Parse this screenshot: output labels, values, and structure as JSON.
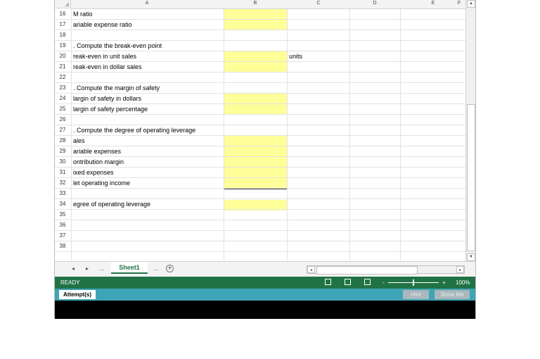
{
  "columns": [
    "A",
    "B",
    "C",
    "D",
    "E",
    "F"
  ],
  "rows": [
    {
      "num": "16",
      "a": "M ratio",
      "c": ""
    },
    {
      "num": "17",
      "a": "ariable expense ratio",
      "c": ""
    },
    {
      "num": "18",
      "a": "",
      "c": ""
    },
    {
      "num": "19",
      "a": ". Compute the break-even point",
      "c": ""
    },
    {
      "num": "20",
      "a": "reak-even in unit sales",
      "c": "units"
    },
    {
      "num": "21",
      "a": "reak-even in dollar sales",
      "c": ""
    },
    {
      "num": "22",
      "a": "",
      "c": ""
    },
    {
      "num": "23",
      "a": ". Compute the margin of safety",
      "c": ""
    },
    {
      "num": "24",
      "a": "largin of safety in dollars",
      "c": ""
    },
    {
      "num": "25",
      "a": "largin of safety percentage",
      "c": ""
    },
    {
      "num": "26",
      "a": "",
      "c": ""
    },
    {
      "num": "27",
      "a": ". Compute the degree of operating leverage",
      "c": ""
    },
    {
      "num": "28",
      "a": "ales",
      "c": ""
    },
    {
      "num": "29",
      "a": "ariable expenses",
      "c": ""
    },
    {
      "num": "30",
      "a": "ontribution margin",
      "c": ""
    },
    {
      "num": "31",
      "a": "ixed expenses",
      "c": ""
    },
    {
      "num": "32",
      "a": "let operating income",
      "c": ""
    },
    {
      "num": "33",
      "a": "",
      "c": ""
    },
    {
      "num": "34",
      "a": "egree of operating leverage",
      "c": ""
    },
    {
      "num": "35",
      "a": "",
      "c": ""
    },
    {
      "num": "36",
      "a": "",
      "c": ""
    },
    {
      "num": "37",
      "a": "",
      "c": ""
    },
    {
      "num": "38",
      "a": "",
      "c": ""
    }
  ],
  "tabs": {
    "prev": "◂",
    "next": "▸",
    "ellipsis": "...",
    "sheet": "Sheet1",
    "ellipsis2": "...",
    "add": "+"
  },
  "status": {
    "ready": "READY",
    "zoom": "100%",
    "minus": "-",
    "plus": "+"
  },
  "attempts": {
    "label": "Attempt(s)",
    "hint": "Hint",
    "show_me": "Show Me"
  },
  "colors": {
    "accent": "#217346",
    "input_fill": "#ffff99",
    "attempt_bar": "#3ea5b6"
  }
}
